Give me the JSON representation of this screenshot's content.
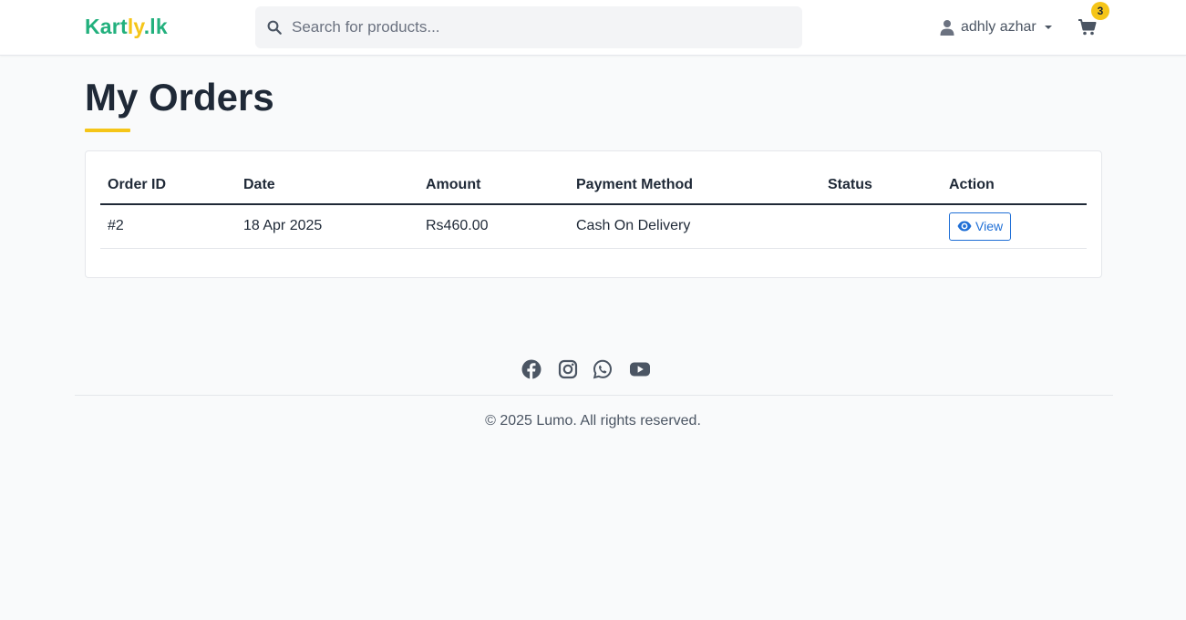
{
  "brand": {
    "parts": [
      {
        "text": "Kart",
        "color": "#22b07d"
      },
      {
        "text": "ly",
        "color": "#f5c518"
      },
      {
        "text": ".lk",
        "color": "#22b07d"
      }
    ]
  },
  "search": {
    "placeholder": "Search for products...",
    "value": "",
    "icon": "search-icon"
  },
  "user_menu": {
    "icon": "user-icon",
    "name": "adhly azhar",
    "caret_icon": "caret-down-icon"
  },
  "cart": {
    "icon": "cart-icon",
    "badge": "3"
  },
  "page": {
    "title": "My Orders",
    "accent_color": "#f5c518"
  },
  "orders_table": {
    "headers": [
      "Order ID",
      "Date",
      "Amount",
      "Payment Method",
      "Status",
      "Action"
    ],
    "rows": [
      {
        "order_id": "#2",
        "date": "18 Apr 2025",
        "amount": "Rs460.00",
        "payment_method": "Cash On Delivery",
        "status": "",
        "action_label": "View",
        "action_icon": "eye-icon"
      }
    ]
  },
  "footer": {
    "social_icons": [
      "facebook-icon",
      "instagram-icon",
      "whatsapp-icon",
      "youtube-icon"
    ],
    "copyright": "© 2025 Lumo. All rights reserved."
  },
  "colors": {
    "link_blue": "#1f6fd6",
    "text_dark": "#1f2937",
    "muted": "#4b5563"
  }
}
